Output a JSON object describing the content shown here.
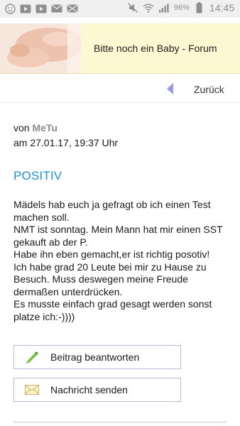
{
  "status_bar": {
    "battery": "96%",
    "time": "14:45"
  },
  "header": {
    "title": "Bitte noch ein Baby - Forum"
  },
  "nav": {
    "back_label": "Zurück"
  },
  "post": {
    "by_prefix": "von",
    "author": "MeTu",
    "date": "am 27.01.17, 19:37 Uhr",
    "title": "POSITIV",
    "body": "Mädels hab euch ja gefragt ob ich einen Test machen soll.\nNMT ist sonntag. Mein Mann hat mir einen SST gekauft ab der P.\nHabe ihn eben gemacht,er ist richtig posotiv!\nIch habe grad 20 Leute bei mir zu Hause zu Besuch. Muss deswegen meine Freude dermaßen unterdrücken.\nEs musste einfach grad gesagt werden sonst platze ich:-))))"
  },
  "actions": {
    "reply_label": "Beitrag beantworten",
    "message_label": "Nachricht senden"
  },
  "colors": {
    "accent": "#1f8fd6",
    "banner_bg": "#fdf7d2",
    "back_arrow": "#9a9ae0"
  }
}
